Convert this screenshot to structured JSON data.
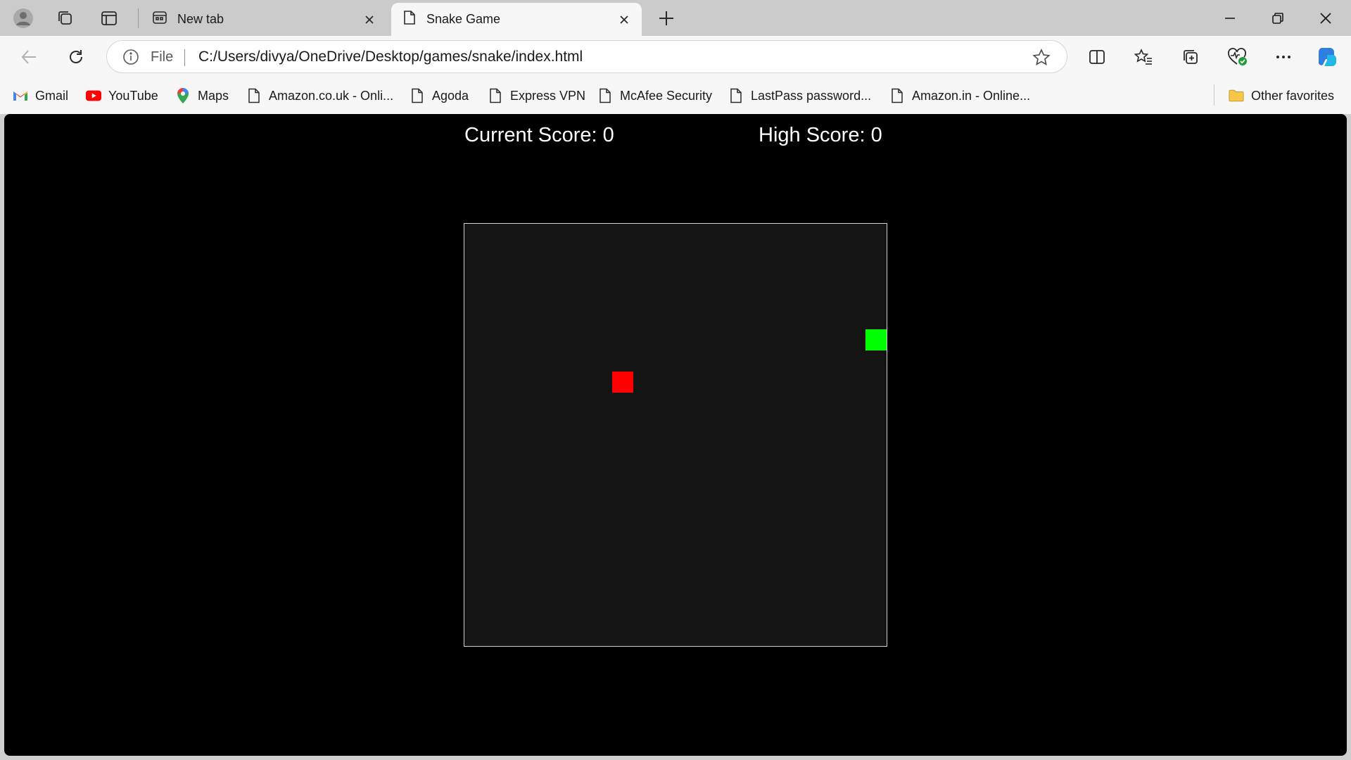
{
  "browser": {
    "tabs": [
      {
        "label": "New tab",
        "icon": "new-tab-page-icon",
        "active": false
      },
      {
        "label": "Snake Game",
        "icon": "page-icon",
        "active": true
      }
    ],
    "address": {
      "scheme_label": "File",
      "url": "C:/Users/divya/OneDrive/Desktop/games/snake/index.html"
    },
    "favorites": [
      {
        "label": "Gmail",
        "icon": "gmail-icon"
      },
      {
        "label": "YouTube",
        "icon": "youtube-icon"
      },
      {
        "label": "Maps",
        "icon": "maps-icon"
      },
      {
        "label": "Amazon.co.uk - Onli...",
        "icon": "page-icon"
      },
      {
        "label": "Agoda",
        "icon": "page-icon"
      },
      {
        "label": "Express VPN",
        "icon": "page-icon"
      },
      {
        "label": "McAfee Security",
        "icon": "page-icon"
      },
      {
        "label": "LastPass password...",
        "icon": "page-icon"
      },
      {
        "label": "Amazon.in - Online...",
        "icon": "page-icon"
      }
    ],
    "other_favorites_label": "Other favorites"
  },
  "game": {
    "current_score_text": "Current Score: 0",
    "high_score_text": "High Score: 0",
    "grid_size": 20,
    "food": {
      "col": 7,
      "row": 7,
      "color": "#ff0000"
    },
    "snake": [
      {
        "col": 19,
        "row": 5
      }
    ],
    "snake_color": "#00ff00",
    "board_color": "#141414"
  }
}
